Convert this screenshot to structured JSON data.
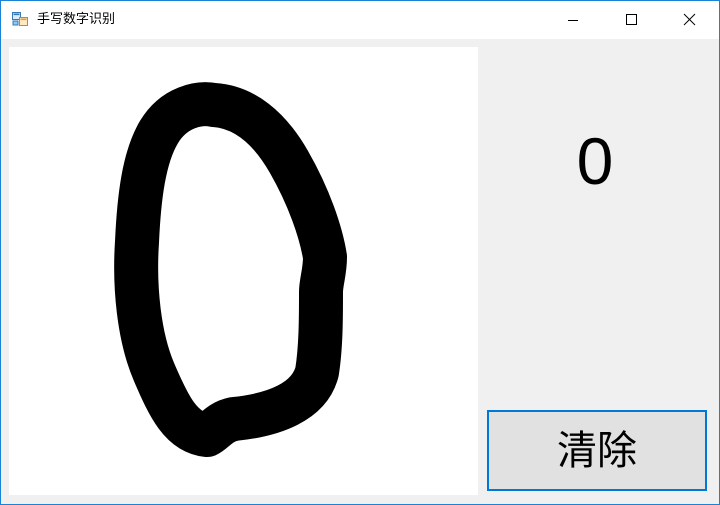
{
  "window": {
    "title": "手写数字识别",
    "accent_color": "#0078d7"
  },
  "titlebar_buttons": {
    "minimize_icon": "minimize-icon",
    "maximize_icon": "maximize-icon",
    "close_icon": "close-icon"
  },
  "canvas": {
    "background_color": "#ffffff",
    "stroke_color": "#000000"
  },
  "result": {
    "predicted_digit": "0"
  },
  "actions": {
    "clear_label": "清除"
  }
}
